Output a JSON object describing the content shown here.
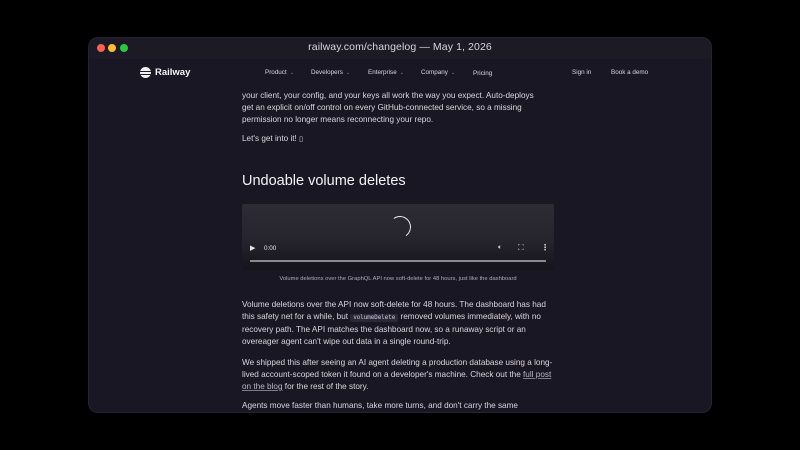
{
  "window": {
    "title": "railway.com/changelog — May 1, 2026"
  },
  "nav": {
    "logo": "Railway",
    "items": [
      {
        "label": "Product",
        "chevron": "chevron-down-icon"
      },
      {
        "label": "Developers",
        "chevron": "chevron-down-icon"
      },
      {
        "label": "Enterprise",
        "chevron": "chevron-down-icon"
      },
      {
        "label": "Company",
        "chevron": "chevron-down-icon"
      }
    ],
    "pricing": "Pricing",
    "sign_in": "Sign in",
    "book_demo": "Book a demo"
  },
  "article": {
    "intro_lines": [
      "your client, your config, and your keys all work the way you expect. Auto-deploys",
      "get an explicit on/off control on every GitHub-connected service, so a missing",
      "permission no longer means reconnecting your repo."
    ],
    "lets_go": "Let's get into it! ",
    "lets_go_glyph": "▯",
    "heading": "Undoable volume deletes",
    "video": {
      "time": "0:00"
    },
    "caption": "Volume deletions over the GraphQL API now soft-delete for 48 hours, just like the dashboard",
    "p1": {
      "before_code": "Volume deletions over the API now soft-delete for 48 hours. The dashboard has had this safety net for a while, but ",
      "code": "volumeDelete",
      "after_code": " removed volumes immediately, with no recovery path. The API matches the dashboard now, so a runaway script or an overeager agent can't wipe out data in a single round-trip."
    },
    "p2": {
      "before_link": "We shipped this after seeing an AI agent deleting a production database using a long-lived account-scoped token it found on a developer's machine. Check out the ",
      "link": "full post on the blog",
      "after_link": " for the rest of the story."
    },
    "p3": "Agents move faster than humans, take more turns, and don't carry the same"
  },
  "colors": {
    "window_bg": "#1a1724",
    "outer_bg": "#000000",
    "text": "#d8d6df"
  }
}
